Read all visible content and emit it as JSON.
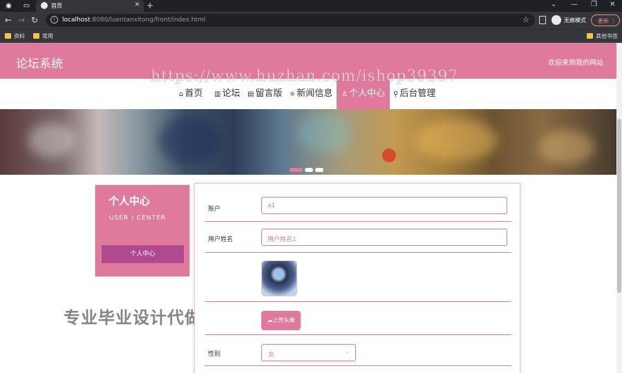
{
  "browser": {
    "tab_title": "首页",
    "url_host": "localhost",
    "url_rest": ":8080/luentanxitong/front/index.html",
    "incognito_label": "无痕模式",
    "update_label": "更新",
    "bookmarks": [
      "资料",
      "常用"
    ],
    "other_bookmarks": "其他书签"
  },
  "header": {
    "title": "论坛系统",
    "welcome": "欢迎来到我的网站"
  },
  "watermarks": {
    "url": "https://www.huzhan.com/ishop39397",
    "promo": "专业毕业设计代做"
  },
  "nav": {
    "items": [
      {
        "icon": "⌂",
        "label": "首页"
      },
      {
        "icon": "▥",
        "label": "论坛"
      },
      {
        "icon": "▤",
        "label": "留言版"
      },
      {
        "icon": "≑",
        "label": "新闻信息"
      },
      {
        "icon": "♙",
        "label": "个人中心"
      },
      {
        "icon": "⚲",
        "label": "后台管理"
      }
    ],
    "active_index": 4
  },
  "banner": {
    "slide_count": 3,
    "active_slide": 0
  },
  "sidebar": {
    "title": "个人中心",
    "subtitle": "USER / CENTER",
    "button": "个人中心"
  },
  "form": {
    "account_label": "账户",
    "account_value": "a1",
    "name_label": "用户姓名",
    "name_value": "用户姓名1",
    "upload_label": "上传头像",
    "upload_icon": "☁",
    "gender_label": "性别",
    "gender_value": "女"
  },
  "colors": {
    "accent": "#e07a9d",
    "sidebar_button": "#b1498e"
  }
}
